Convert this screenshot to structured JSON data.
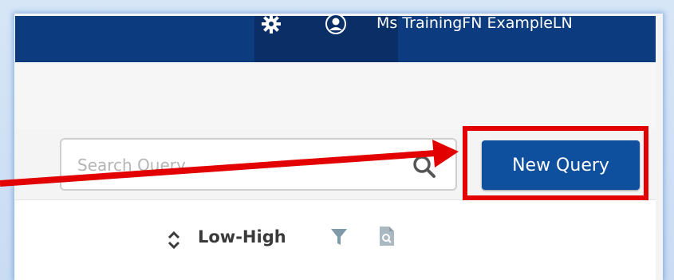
{
  "header": {
    "user_name": "Ms TrainingFN ExampleLN",
    "settings_icon": "gear-icon",
    "account_icon": "user-avatar-icon"
  },
  "toolbar": {
    "search_placeholder": "Search Query",
    "search_icon": "magnifier-icon",
    "new_query_label": "New Query"
  },
  "sort_bar": {
    "sort_label": "Low-High",
    "sort_icon": "sort-updown-icon",
    "filter_icon": "filter-icon",
    "preview_icon": "document-search-icon"
  },
  "annotation": {
    "highlight_color": "#e30000",
    "arrow_color": "#e30000"
  },
  "colors": {
    "topbar": "#0d3b7f",
    "primary_button": "#0e4f9e"
  }
}
